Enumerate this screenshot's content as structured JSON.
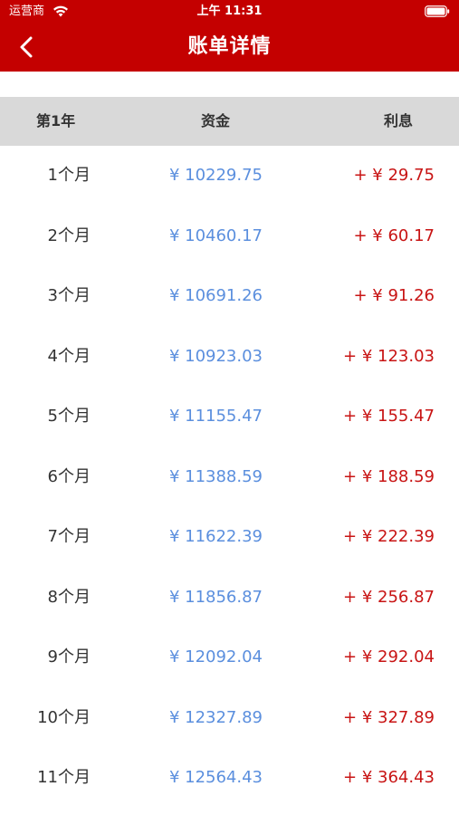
{
  "status_bar": {
    "carrier": "运营商",
    "time": "上午 11:31"
  },
  "nav": {
    "title": "账单详情",
    "back_icon": "chevron-left-icon"
  },
  "table": {
    "headers": {
      "year": "第1年",
      "capital": "资金",
      "interest": "利息"
    },
    "rows": [
      {
        "month": "1个月",
        "capital": "¥ 10229.75",
        "interest": "+ ¥ 29.75"
      },
      {
        "month": "2个月",
        "capital": "¥ 10460.17",
        "interest": "+ ¥ 60.17"
      },
      {
        "month": "3个月",
        "capital": "¥ 10691.26",
        "interest": "+ ¥ 91.26"
      },
      {
        "month": "4个月",
        "capital": "¥ 10923.03",
        "interest": "+ ¥ 123.03"
      },
      {
        "month": "5个月",
        "capital": "¥ 11155.47",
        "interest": "+ ¥ 155.47"
      },
      {
        "month": "6个月",
        "capital": "¥ 11388.59",
        "interest": "+ ¥ 188.59"
      },
      {
        "month": "7个月",
        "capital": "¥ 11622.39",
        "interest": "+ ¥ 222.39"
      },
      {
        "month": "8个月",
        "capital": "¥ 11856.87",
        "interest": "+ ¥ 256.87"
      },
      {
        "month": "9个月",
        "capital": "¥ 12092.04",
        "interest": "+ ¥ 292.04"
      },
      {
        "month": "10个月",
        "capital": "¥ 12327.89",
        "interest": "+ ¥ 327.89"
      },
      {
        "month": "11个月",
        "capital": "¥ 12564.43",
        "interest": "+ ¥ 364.43"
      }
    ]
  },
  "colors": {
    "brand": "#c40000",
    "capital": "#5b8fde",
    "interest": "#c81414",
    "header_bg": "#d9d9d9"
  }
}
